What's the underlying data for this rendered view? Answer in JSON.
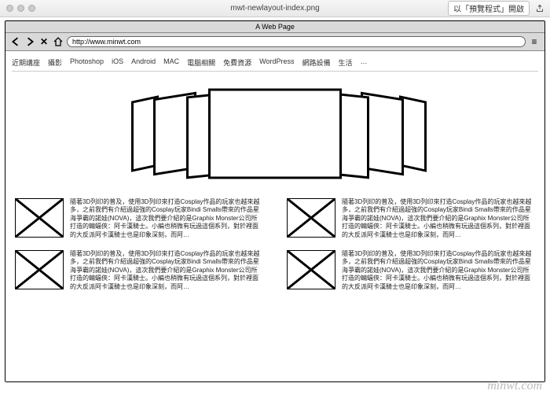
{
  "os_header": {
    "tab_title": "mwt-newlayout-index.png",
    "preview_button": "以「預覽程式」開啟"
  },
  "browser": {
    "page_label": "A Web Page",
    "url": "http://www.minwt.com"
  },
  "nav": {
    "items": [
      "近期講座",
      "攝影",
      "Photoshop",
      "iOS",
      "Android",
      "MAC",
      "電腦相關",
      "免費資源",
      "WordPress",
      "網路設備",
      "生活",
      "…"
    ]
  },
  "articles": [
    {
      "excerpt": "隨著3D列印的普及，使用3D列印來打造Cosplay作品的玩家也越來越多，之前我們有介紹過超強的Cosplay玩家Bindi Smalls帶來的作品星海爭霸的諾娃(NOVA)，這次我們要介紹的是Graphix Monster公司所打造的蝙蝠俠：阿卡漢騎士。小編也稍微有玩過這個系列，對於裡面的大反派阿卡漢騎士也是印象深刻，而阿…"
    },
    {
      "excerpt": "隨著3D列印的普及，使用3D列印來打造Cosplay作品的玩家也越來越多，之前我們有介紹過超強的Cosplay玩家Bindi Smalls帶來的作品星海爭霸的諾娃(NOVA)，這次我們要介紹的是Graphix Monster公司所打造的蝙蝠俠：阿卡漢騎士。小編也稍微有玩過這個系列，對於裡面的大反派阿卡漢騎士也是印象深刻，而阿…"
    },
    {
      "excerpt": "隨著3D列印的普及，使用3D列印來打造Cosplay作品的玩家也越來越多，之前我們有介紹過超強的Cosplay玩家Bindi Smalls帶來的作品星海爭霸的諾娃(NOVA)，這次我們要介紹的是Graphix Monster公司所打造的蝙蝠俠：阿卡漢騎士。小編也稍微有玩過這個系列，對於裡面的大反派阿卡漢騎士也是印象深刻，而阿…"
    },
    {
      "excerpt": "隨著3D列印的普及，使用3D列印來打造Cosplay作品的玩家也越來越多，之前我們有介紹過超強的Cosplay玩家Bindi Smalls帶來的作品星海爭霸的諾娃(NOVA)，這次我們要介紹的是Graphix Monster公司所打造的蝙蝠俠：阿卡漢騎士。小編也稍微有玩過這個系列，對於裡面的大反派阿卡漢騎士也是印象深刻，而阿…"
    }
  ],
  "watermark": "minwt.com"
}
